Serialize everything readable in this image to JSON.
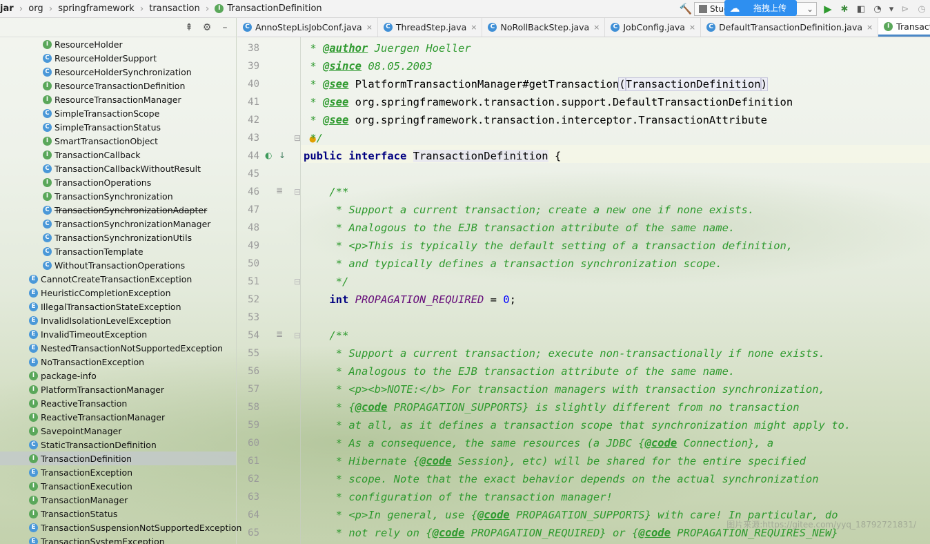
{
  "breadcrumbs": [
    "jar",
    "org",
    "springframework",
    "transaction",
    "TransactionDefinition"
  ],
  "toolbar": {
    "run_config": "Stud",
    "upload_label": "拖拽上传"
  },
  "tree": [
    {
      "icon": "I",
      "kind": "i",
      "indent": 62,
      "label": "ResourceHolder"
    },
    {
      "icon": "C",
      "kind": "c",
      "indent": 62,
      "label": "ResourceHolderSupport"
    },
    {
      "icon": "C",
      "kind": "c",
      "indent": 62,
      "label": "ResourceHolderSynchronization"
    },
    {
      "icon": "I",
      "kind": "i",
      "indent": 62,
      "label": "ResourceTransactionDefinition"
    },
    {
      "icon": "I",
      "kind": "i",
      "indent": 62,
      "label": "ResourceTransactionManager"
    },
    {
      "icon": "C",
      "kind": "c",
      "indent": 62,
      "label": "SimpleTransactionScope"
    },
    {
      "icon": "C",
      "kind": "c",
      "indent": 62,
      "label": "SimpleTransactionStatus"
    },
    {
      "icon": "I",
      "kind": "i",
      "indent": 62,
      "label": "SmartTransactionObject"
    },
    {
      "icon": "I",
      "kind": "i",
      "indent": 62,
      "label": "TransactionCallback"
    },
    {
      "icon": "C",
      "kind": "c",
      "indent": 62,
      "label": "TransactionCallbackWithoutResult"
    },
    {
      "icon": "I",
      "kind": "i",
      "indent": 62,
      "label": "TransactionOperations"
    },
    {
      "icon": "I",
      "kind": "i",
      "indent": 62,
      "label": "TransactionSynchronization"
    },
    {
      "icon": "C",
      "kind": "c",
      "indent": 62,
      "label": "TransactionSynchronizationAdapter",
      "strike": true
    },
    {
      "icon": "C",
      "kind": "c",
      "indent": 62,
      "label": "TransactionSynchronizationManager"
    },
    {
      "icon": "C",
      "kind": "c",
      "indent": 62,
      "label": "TransactionSynchronizationUtils"
    },
    {
      "icon": "C",
      "kind": "c",
      "indent": 62,
      "label": "TransactionTemplate"
    },
    {
      "icon": "C",
      "kind": "c",
      "indent": 62,
      "label": "WithoutTransactionOperations"
    },
    {
      "icon": "E",
      "kind": "e",
      "indent": 42,
      "label": "CannotCreateTransactionException"
    },
    {
      "icon": "E",
      "kind": "e",
      "indent": 42,
      "label": "HeuristicCompletionException"
    },
    {
      "icon": "E",
      "kind": "e",
      "indent": 42,
      "label": "IllegalTransactionStateException"
    },
    {
      "icon": "E",
      "kind": "e",
      "indent": 42,
      "label": "InvalidIsolationLevelException"
    },
    {
      "icon": "E",
      "kind": "e",
      "indent": 42,
      "label": "InvalidTimeoutException"
    },
    {
      "icon": "E",
      "kind": "e",
      "indent": 42,
      "label": "NestedTransactionNotSupportedException"
    },
    {
      "icon": "E",
      "kind": "e",
      "indent": 42,
      "label": "NoTransactionException"
    },
    {
      "icon": "I",
      "kind": "i",
      "indent": 42,
      "label": "package-info"
    },
    {
      "icon": "I",
      "kind": "i",
      "indent": 42,
      "label": "PlatformTransactionManager"
    },
    {
      "icon": "I",
      "kind": "i",
      "indent": 42,
      "label": "ReactiveTransaction"
    },
    {
      "icon": "I",
      "kind": "i",
      "indent": 42,
      "label": "ReactiveTransactionManager"
    },
    {
      "icon": "I",
      "kind": "i",
      "indent": 42,
      "label": "SavepointManager"
    },
    {
      "icon": "C",
      "kind": "c",
      "indent": 42,
      "label": "StaticTransactionDefinition"
    },
    {
      "icon": "I",
      "kind": "i",
      "indent": 42,
      "label": "TransactionDefinition",
      "selected": true
    },
    {
      "icon": "E",
      "kind": "e",
      "indent": 42,
      "label": "TransactionException"
    },
    {
      "icon": "I",
      "kind": "i",
      "indent": 42,
      "label": "TransactionExecution"
    },
    {
      "icon": "I",
      "kind": "i",
      "indent": 42,
      "label": "TransactionManager"
    },
    {
      "icon": "I",
      "kind": "i",
      "indent": 42,
      "label": "TransactionStatus"
    },
    {
      "icon": "E",
      "kind": "e",
      "indent": 42,
      "label": "TransactionSuspensionNotSupportedException"
    },
    {
      "icon": "E",
      "kind": "e",
      "indent": 42,
      "label": "TransactionSystemException"
    }
  ],
  "tabs": [
    {
      "label": "AnnoStepLisJobConf.java",
      "icon": "C",
      "active": false
    },
    {
      "label": "ThreadStep.java",
      "icon": "C",
      "active": false
    },
    {
      "label": "NoRollBackStep.java",
      "icon": "C",
      "active": false
    },
    {
      "label": "JobConfig.java",
      "icon": "C",
      "active": false
    },
    {
      "label": "DefaultTransactionDefinition.java",
      "icon": "C",
      "active": false
    },
    {
      "label": "TransactionDefiniti",
      "icon": "I",
      "active": true
    }
  ],
  "code": [
    {
      "n": "38",
      "html": "<span class='cm'> * </span><span class='tag'>@author</span><span class='cm'> Juergen Hoeller</span>"
    },
    {
      "n": "39",
      "html": "<span class='cm'> * </span><span class='tag'>@since</span><span class='cm'> 08.05.2003</span>"
    },
    {
      "n": "40",
      "html": "<span class='cm'> * </span><span class='tag'>@see</span> PlatformTransactionManager#getTransaction<span class='hl'>(</span><span class='hl'>TransactionDefinition</span><span class='hl'>)</span>"
    },
    {
      "n": "41",
      "html": "<span class='cm'> * </span><span class='tag'>@see</span> org.springframework.transaction.support.DefaultTransactionDefinition"
    },
    {
      "n": "42",
      "html": "<span class='cm'> * </span><span class='tag'>@see</span> org.springframework.transaction.interceptor.TransactionAttribute"
    },
    {
      "n": "43",
      "html": "<span class='cm'> */</span>"
    },
    {
      "n": "44",
      "html": "<span class='kw'>public interface </span><span class='cls-sel'>TransactionDefinition</span> {"
    },
    {
      "n": "45",
      "html": ""
    },
    {
      "n": "46",
      "html": "<span class='cm'>    /**</span>"
    },
    {
      "n": "47",
      "html": "<span class='cm'>     * Support a current transaction; create a new one if none exists.</span>"
    },
    {
      "n": "48",
      "html": "<span class='cm'>     * Analogous to the EJB transaction attribute of the same name.</span>"
    },
    {
      "n": "49",
      "html": "<span class='cm'>     * &lt;p&gt;This is typically the default setting of a transaction definition,</span>"
    },
    {
      "n": "50",
      "html": "<span class='cm'>     * and typically defines a transaction synchronization scope.</span>"
    },
    {
      "n": "51",
      "html": "<span class='cm'>     */</span>"
    },
    {
      "n": "52",
      "html": "    <span class='kw'>int </span><span class='const'>PROPAGATION_REQUIRED</span> = <span class='num'>0</span>;"
    },
    {
      "n": "53",
      "html": ""
    },
    {
      "n": "54",
      "html": "<span class='cm'>    /**</span>"
    },
    {
      "n": "55",
      "html": "<span class='cm'>     * Support a current transaction; execute non-transactionally if none exists.</span>"
    },
    {
      "n": "56",
      "html": "<span class='cm'>     * Analogous to the EJB transaction attribute of the same name.</span>"
    },
    {
      "n": "57",
      "html": "<span class='cm'>     * &lt;p&gt;&lt;b&gt;NOTE:&lt;/b&gt; For transaction managers with transaction synchronization,</span>"
    },
    {
      "n": "58",
      "html": "<span class='cm'>     * {</span><span class='tag'>@code</span><span class='cm'> PROPAGATION_SUPPORTS} is slightly different from no transaction</span>"
    },
    {
      "n": "59",
      "html": "<span class='cm'>     * at all, as it defines a transaction scope that synchronization might apply to.</span>"
    },
    {
      "n": "60",
      "html": "<span class='cm'>     * As a consequence, the same resources (a JDBC {</span><span class='tag'>@code</span><span class='cm'> Connection}, a</span>"
    },
    {
      "n": "61",
      "html": "<span class='cm'>     * Hibernate {</span><span class='tag'>@code</span><span class='cm'> Session}, etc) will be shared for the entire specified</span>"
    },
    {
      "n": "62",
      "html": "<span class='cm'>     * scope. Note that the exact behavior depends on the actual synchronization</span>"
    },
    {
      "n": "63",
      "html": "<span class='cm'>     * configuration of the transaction manager!</span>"
    },
    {
      "n": "64",
      "html": "<span class='cm'>     * &lt;p&gt;In general, use {</span><span class='tag'>@code</span><span class='cm'> PROPAGATION_SUPPORTS} with care! In particular, do</span>"
    },
    {
      "n": "65",
      "html": "<span class='cm'>     * not rely on {</span><span class='tag'>@code</span><span class='cm'> PROPAGATION_REQUIRED} or {</span><span class='tag'>@code</span><span class='cm'> PROPAGATION_REQUIRES_NEW}</span>"
    }
  ],
  "watermark": "图片来源:https://gitee.com/yyq_18792721831/"
}
